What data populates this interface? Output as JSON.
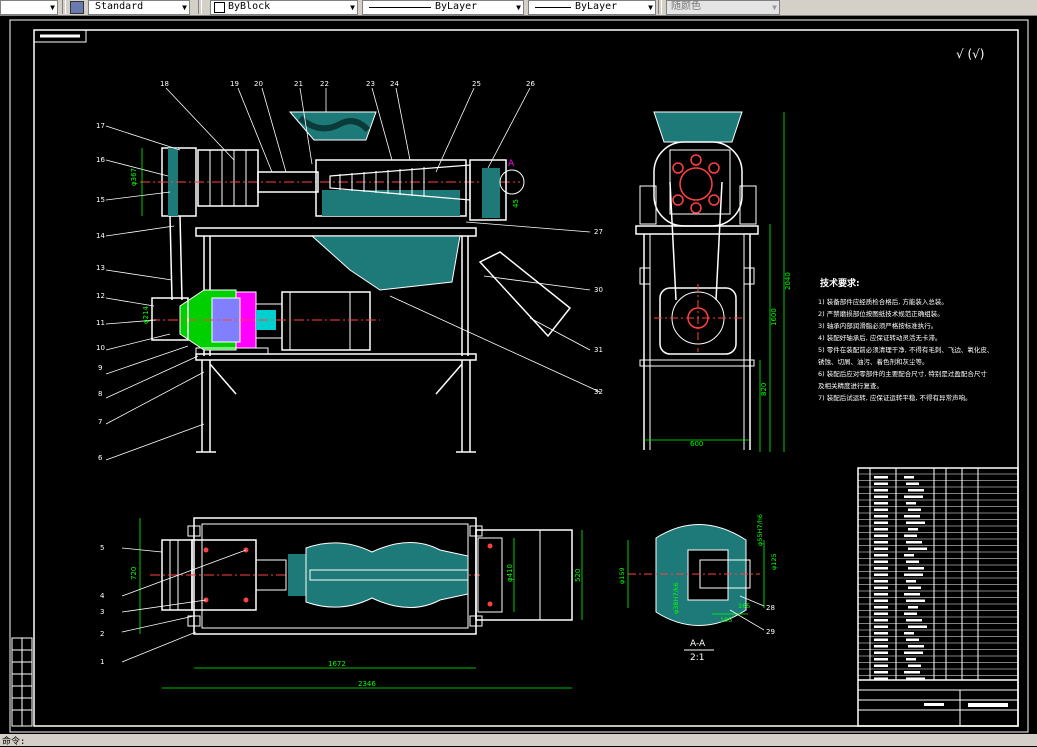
{
  "toolbar": {
    "text_style": "Standard",
    "color_control": "ByBlock",
    "linetype_control": "ByLayer",
    "lineweight_control": "ByLayer",
    "plotstyle_control": "随颜色"
  },
  "drawing": {
    "tech_title": "技术要求:",
    "tech_requirements": [
      "1) 装备部件应经质检合格后, 方能装入总装。",
      "2) 严禁磨损部位按图纸技术规范正确组装。",
      "3) 轴承内部润滑脂必须严格按标准执行。",
      "4) 装配好轴承后, 应保证转动灵活无卡滞。",
      "5) 零件在装配前必须清理干净, 不得有毛刺、飞边、氧化皮、",
      "锈蚀、切屑、油污、着色剂和灰尘等。",
      "6) 装配后应对零部件的主要配合尺寸, 特别是过盈配合尺寸",
      "及相关精度进行复查。",
      "7) 装配后试运转, 应保证运转平稳, 不得有异常声响。"
    ],
    "section_label": "A-A",
    "section_scale": "2:1",
    "roughness": "√ (√)",
    "callout_A": "A",
    "part_numbers_left": [
      "17",
      "16",
      "15",
      "14",
      "13",
      "12",
      "11",
      "10",
      "9",
      "8",
      "7",
      "6"
    ],
    "part_numbers_top": [
      "18",
      "19",
      "20",
      "21",
      "22",
      "23",
      "24",
      "25",
      "26"
    ],
    "part_numbers_right": [
      "27",
      "30",
      "31",
      "32"
    ],
    "part_numbers_plan": [
      "5",
      "4",
      "3",
      "2",
      "1"
    ],
    "detail_numbers": [
      "28",
      "29"
    ],
    "dims": {
      "d1": "φ367",
      "d2": "φ214",
      "d3": "φ410",
      "d4": "1672",
      "d5": "2346",
      "d6": "720",
      "d7": "520",
      "d8": "2040",
      "d9": "1600",
      "d10": "820",
      "d11": "600",
      "d12": "φ159",
      "d13": "φ38H7/h6",
      "d14": "φ55H7/h6",
      "d15": "φ125",
      "d16": "105",
      "d17": "165",
      "d18": "φ38H7/k6",
      "d19": "45"
    }
  },
  "status": {
    "command": "命令:"
  }
}
